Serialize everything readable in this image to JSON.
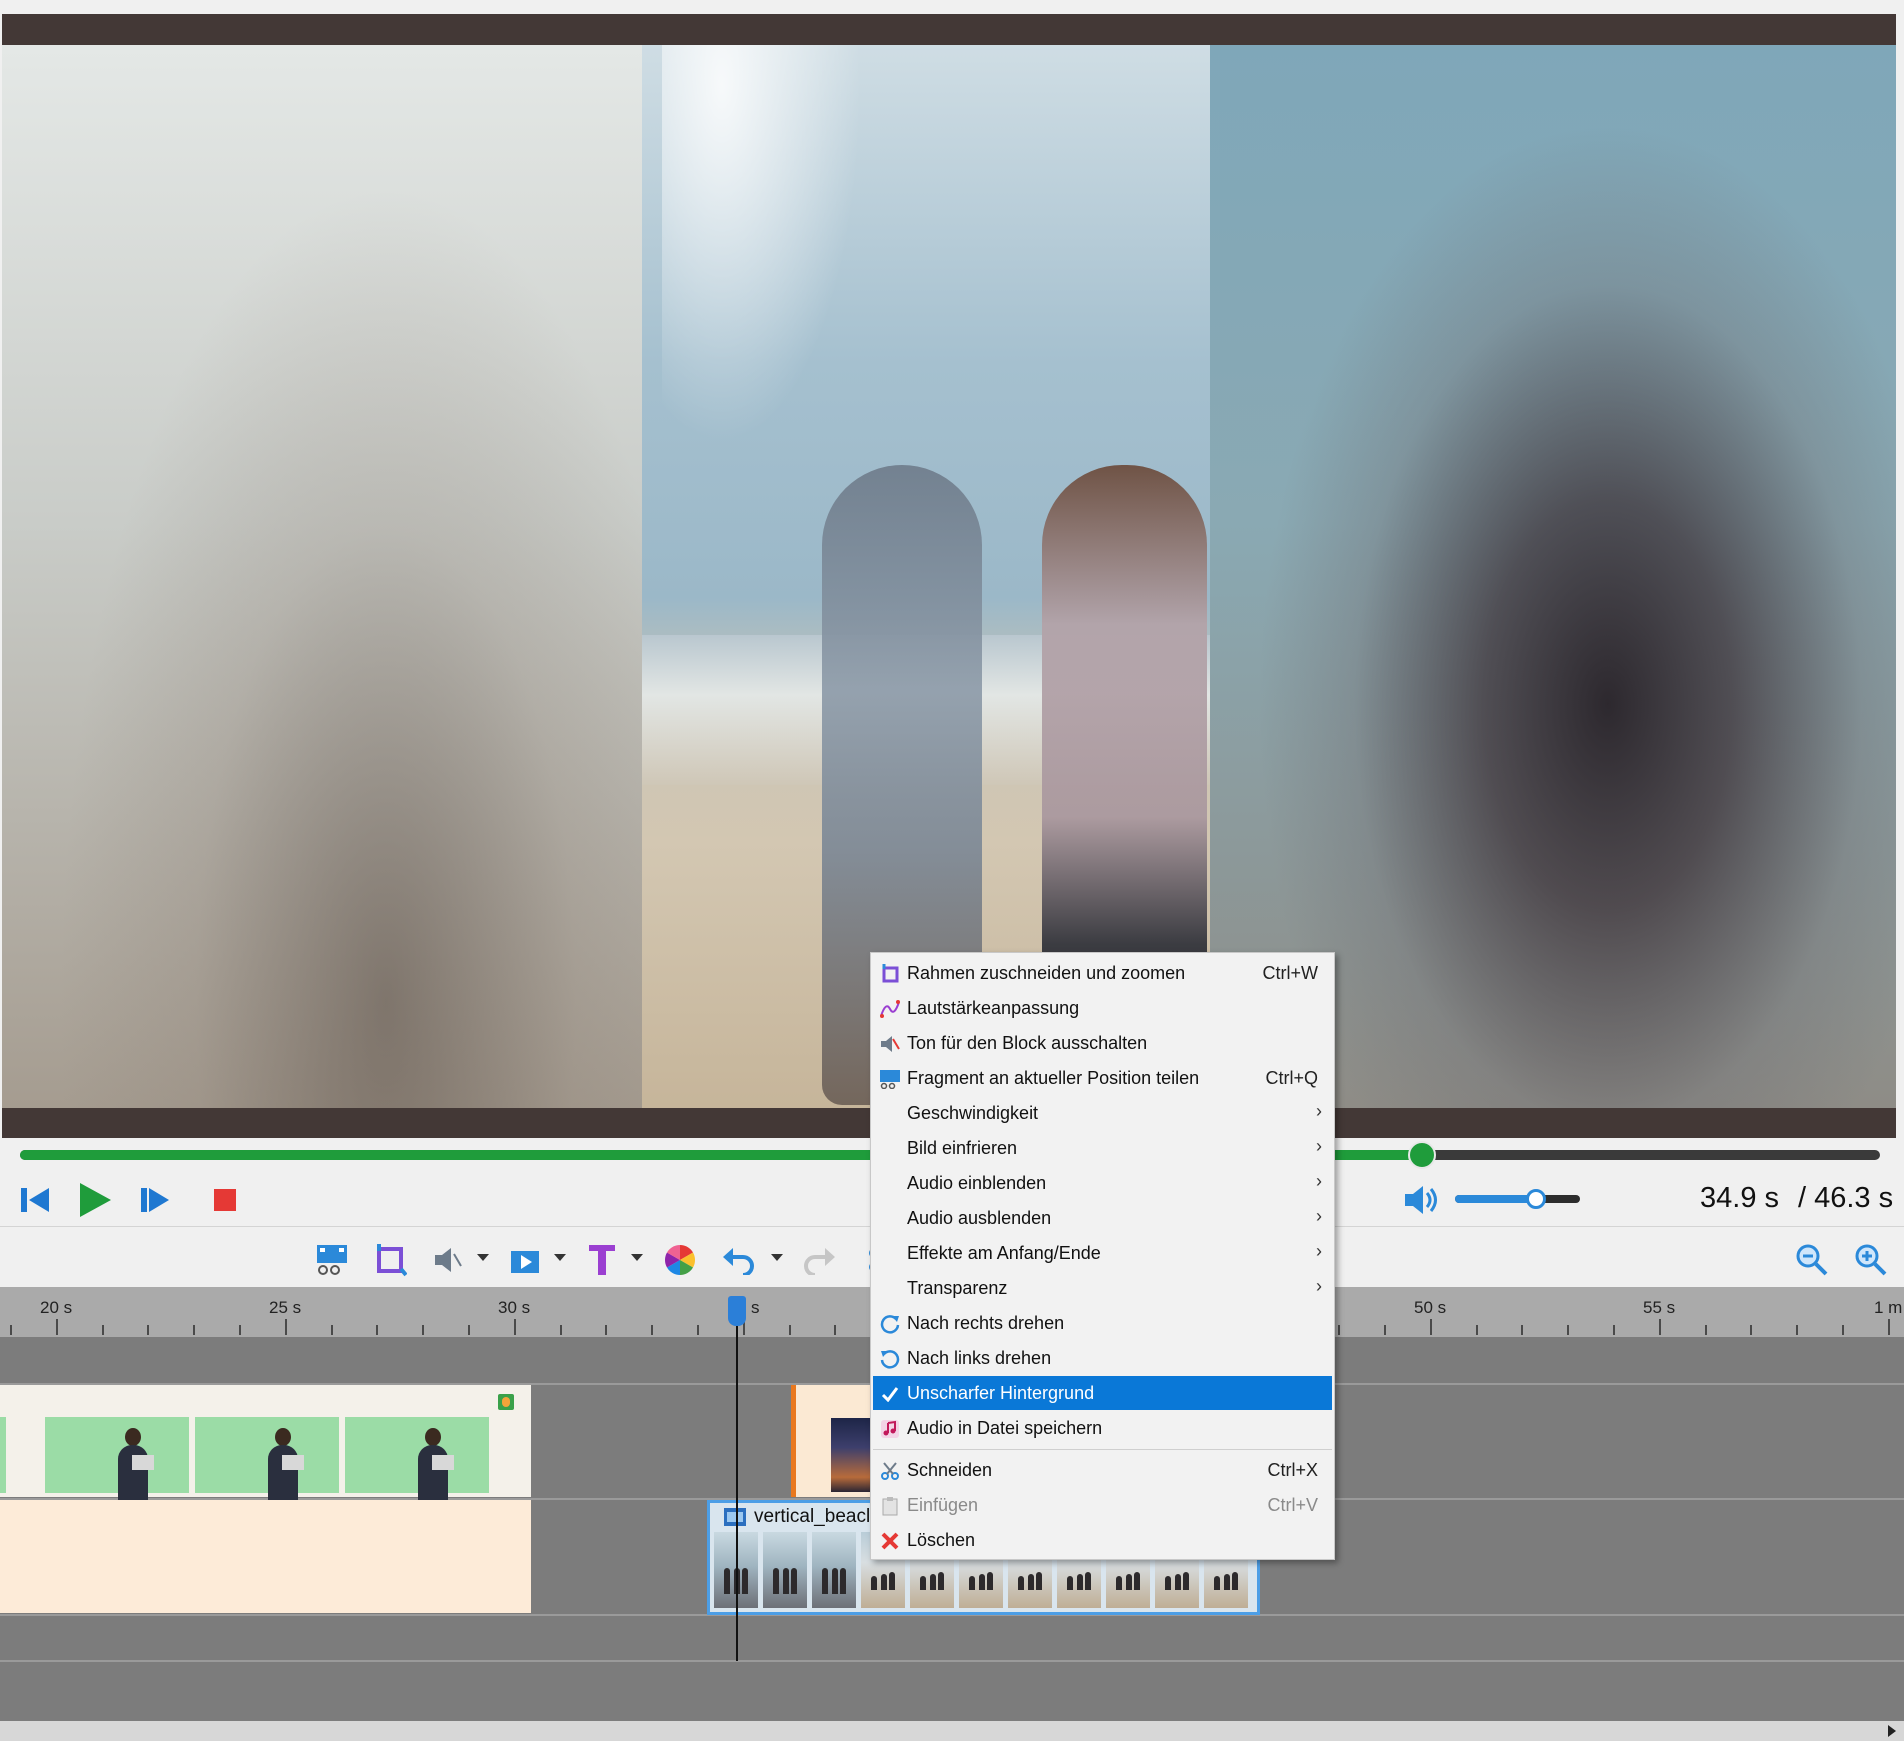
{
  "player": {
    "current_time": "34.9 s",
    "total_time": "/ 46.3 s",
    "progress": 0.754,
    "volume": 0.65
  },
  "timeline": {
    "ruler_labels": [
      "20 s",
      "25 s",
      "30 s",
      "s",
      "50 s",
      "55 s",
      "1 m"
    ],
    "beach_clip_name": "vertical_beacl"
  },
  "context_menu": {
    "items": [
      {
        "label": "Rahmen zuschneiden und zoomen",
        "shortcut": "Ctrl+W",
        "icon": "crop-icon"
      },
      {
        "label": "Lautstärkeanpassung",
        "shortcut": "",
        "icon": "volume-curve-icon"
      },
      {
        "label": "Ton für den Block ausschalten",
        "shortcut": "",
        "icon": "mute-icon"
      },
      {
        "label": "Fragment an aktueller Position teilen",
        "shortcut": "Ctrl+Q",
        "icon": "split-icon"
      },
      {
        "label": "Geschwindigkeit",
        "shortcut": "",
        "icon": "",
        "submenu": true
      },
      {
        "label": "Bild einfrieren",
        "shortcut": "",
        "icon": "",
        "submenu": true
      },
      {
        "label": "Audio einblenden",
        "shortcut": "",
        "icon": "",
        "submenu": true
      },
      {
        "label": "Audio ausblenden",
        "shortcut": "",
        "icon": "",
        "submenu": true
      },
      {
        "label": "Effekte am Anfang/Ende",
        "shortcut": "",
        "icon": "",
        "submenu": true
      },
      {
        "label": "Transparenz",
        "shortcut": "",
        "icon": "",
        "submenu": true
      },
      {
        "label": "Nach rechts drehen",
        "shortcut": "",
        "icon": "rotate-right-icon"
      },
      {
        "label": "Nach links drehen",
        "shortcut": "",
        "icon": "rotate-left-icon"
      },
      {
        "label": "Unscharfer Hintergrund",
        "shortcut": "",
        "icon": "checkmark-icon",
        "checked": true
      },
      {
        "label": "Audio in Datei speichern",
        "shortcut": "",
        "icon": "music-note-icon"
      },
      {
        "label": "Schneiden",
        "shortcut": "Ctrl+X",
        "icon": "scissors-icon"
      },
      {
        "label": "Einfügen",
        "shortcut": "Ctrl+V",
        "icon": "paste-icon",
        "disabled": true
      },
      {
        "label": "Löschen",
        "shortcut": "",
        "icon": "delete-x-icon"
      }
    ]
  },
  "colors": {
    "accent": "#0a78d7",
    "progress": "#1f9c3b",
    "stop": "#e53935",
    "play": "#1f9c3b",
    "nav": "#1f78d1"
  }
}
